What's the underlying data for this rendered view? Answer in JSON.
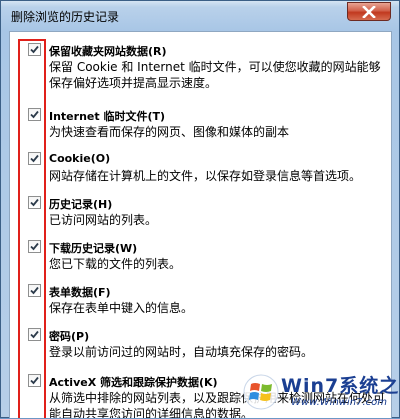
{
  "window": {
    "title": "删除浏览的历史记录"
  },
  "items": [
    {
      "title": "保留收藏夹网站数据(R)",
      "desc": "保留 Cookie 和 Internet 临时文件，可以使您收藏的网站能够保存偏好选项并提高显示速度。",
      "checked": true
    },
    {
      "title": "Internet 临时文件(T)",
      "desc": "为快速查看而保存的网页、图像和媒体的副本",
      "checked": true
    },
    {
      "title": "Cookie(O)",
      "desc": "网站存储在计算机上的文件，以保存如登录信息等首选项。",
      "checked": true
    },
    {
      "title": "历史记录(H)",
      "desc": "已访问网站的列表。",
      "checked": true
    },
    {
      "title": "下载历史记录(W)",
      "desc": "您已下载的文件的列表。",
      "checked": true
    },
    {
      "title": "表单数据(F)",
      "desc": "保存在表单中键入的信息。",
      "checked": true
    },
    {
      "title": "密码(P)",
      "desc": "登录以前访问过的网站时，自动填充保存的密码。",
      "checked": true
    },
    {
      "title": "ActiveX 筛选和跟踪保护数据(K)",
      "desc": "从筛选中排除的网站列表，以及跟踪保护用来检测网站在何处可能自动共享您访问的详细信息的数据。",
      "checked": true
    }
  ],
  "watermark": {
    "brand": "Win7系统之家",
    "url": "Www.Winwin7.com"
  },
  "colors": {
    "highlight_frame": "#e0201a",
    "checkmark": "#2b3a4a"
  }
}
